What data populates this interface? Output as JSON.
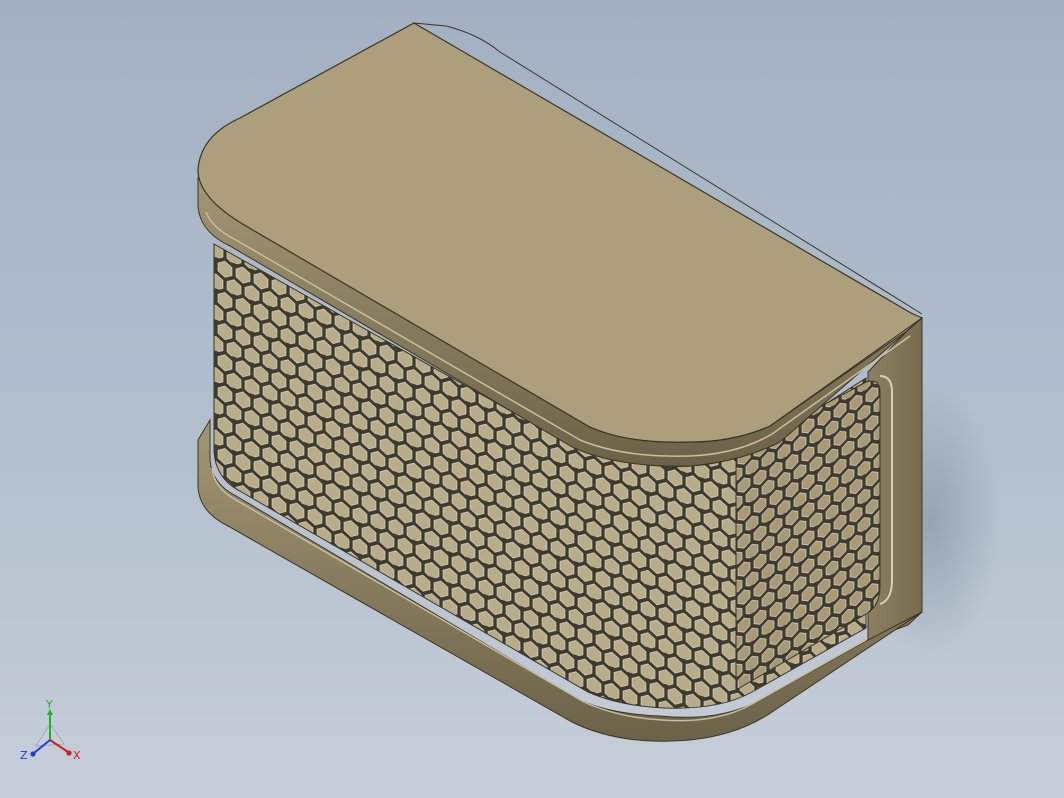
{
  "viewport": {
    "model": "honeycomb-mesh-box",
    "colors": {
      "background_top": "#a2b0c2",
      "background_bottom": "#c6ced9",
      "part_face": "#ad9f7c",
      "part_side": "#8f8361",
      "part_dark": "#5e5640",
      "mesh_fill": "#b9ac88",
      "mesh_stroke": "#4f4a3c",
      "edge": "#3a3627"
    }
  },
  "triad": {
    "x_label": "X",
    "y_label": "Y",
    "z_label": "Z",
    "x_color": "#d01e1e",
    "y_color": "#1eb21e",
    "z_color": "#1e3fd0"
  }
}
